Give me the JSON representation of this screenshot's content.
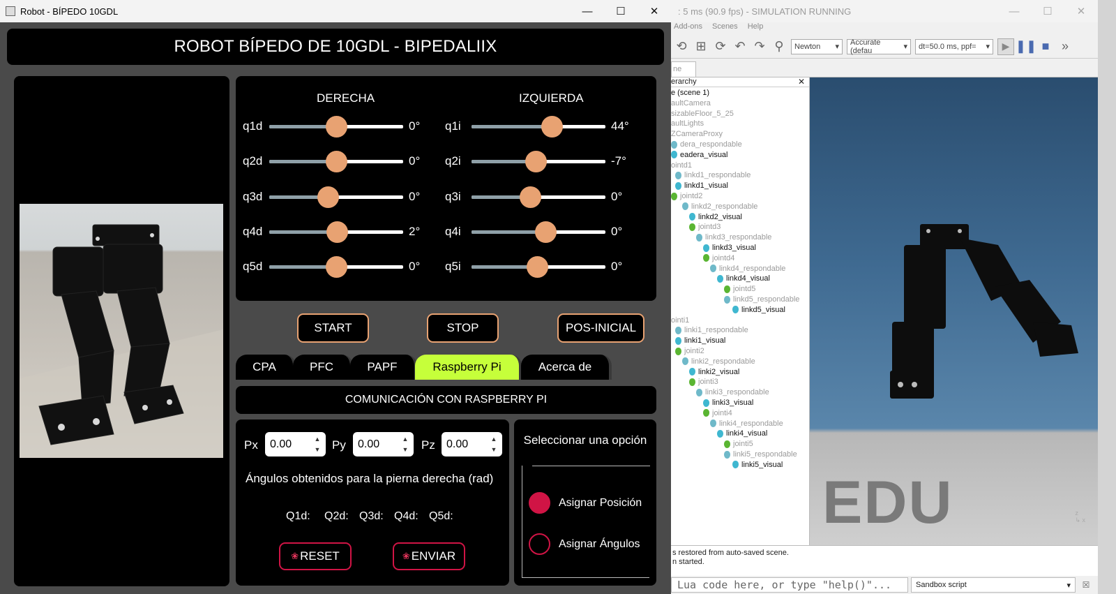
{
  "app": {
    "title": "Robot - BÍPEDO 10GDL",
    "header": "ROBOT BÍPEDO DE 10GDL - BIPEDALIIX",
    "sliders": {
      "right_title": "DERECHA",
      "left_title": "IZQUIERDA",
      "right": [
        {
          "label": "q1d",
          "value": "0°",
          "pos": 0.5
        },
        {
          "label": "q2d",
          "value": "0°",
          "pos": 0.5
        },
        {
          "label": "q3d",
          "value": "0°",
          "pos": 0.44
        },
        {
          "label": "q4d",
          "value": "2°",
          "pos": 0.505
        },
        {
          "label": "q5d",
          "value": "0°",
          "pos": 0.5
        }
      ],
      "left": [
        {
          "label": "q1i",
          "value": "44°",
          "pos": 0.6
        },
        {
          "label": "q2i",
          "value": "-7°",
          "pos": 0.48
        },
        {
          "label": "q3i",
          "value": "0°",
          "pos": 0.44
        },
        {
          "label": "q4i",
          "value": "0°",
          "pos": 0.55
        },
        {
          "label": "q5i",
          "value": "0°",
          "pos": 0.49
        }
      ]
    },
    "buttons": {
      "start": "START",
      "stop": "STOP",
      "pos_inicial": "POS-INICIAL"
    },
    "tabs": [
      "CPA",
      "PFC",
      "PAPF",
      "Raspberry Pi",
      "Acerca de"
    ],
    "active_tab": "Raspberry Pi",
    "comm_title": "COMUNICACIÓN CON RASPBERRY PI",
    "coords": [
      {
        "label": "Px",
        "value": "0.00"
      },
      {
        "label": "Py",
        "value": "0.00"
      },
      {
        "label": "Pz",
        "value": "0.00"
      }
    ],
    "angles_title": "Ángulos obtenidos para la pierna derecha (rad)",
    "q_labels": [
      "Q1d:",
      "Q2d:",
      "Q3d:",
      "Q4d:",
      "Q5d:"
    ],
    "reset": "RESET",
    "enviar": "ENVIAR",
    "option_title": "Seleccionar una opción",
    "options": [
      {
        "label": "Asignar Posición",
        "selected": true
      },
      {
        "label": "Asignar Ángulos",
        "selected": false
      }
    ],
    "colors": {
      "accent_orange": "#e8a272",
      "accent_red": "#d01445",
      "active_tab": "#c6ff3a",
      "track_fill": "#8fa0a8"
    }
  },
  "sim": {
    "title": ": 5 ms (90.9 fps) - SIMULATION RUNNING",
    "menu": [
      "Add-ons",
      "Scenes",
      "Help"
    ],
    "engine": "Newton",
    "accuracy": "Accurate (defau",
    "dt": "dt=50.0 ms, ppf=",
    "scene_tab": "ne",
    "hierarchy_title": "erarchy",
    "hierarchy": [
      "e (scene 1)",
      "aultCamera",
      "sizableFloor_5_25",
      "aultLights",
      "ZCameraProxy",
      "dera_respondable",
      "eadera_visual",
      "ointd1",
      "linkd1_respondable",
      "linkd1_visual",
      "jointd2",
      "linkd2_respondable",
      "linkd2_visual",
      "jointd3",
      "linkd3_respondable",
      "linkd3_visual",
      "jointd4",
      "linkd4_respondable",
      "linkd4_visual",
      "jointd5",
      "linkd5_respondable",
      "linkd5_visual",
      "ointi1",
      "linki1_respondable",
      "linki1_visual",
      "jointi2",
      "linki2_respondable",
      "linki2_visual",
      "jointi3",
      "linki3_respondable",
      "linki3_visual",
      "jointi4",
      "linki4_respondable",
      "linki4_visual",
      "jointi5",
      "linki5_respondable",
      "linki5_visual"
    ],
    "watermark": "EDU",
    "console": [
      "s restored from auto-saved scene.",
      "n started."
    ],
    "lua_placeholder": "Lua code here, or type \"help()\"...",
    "script_mode": "Sandbox script"
  }
}
